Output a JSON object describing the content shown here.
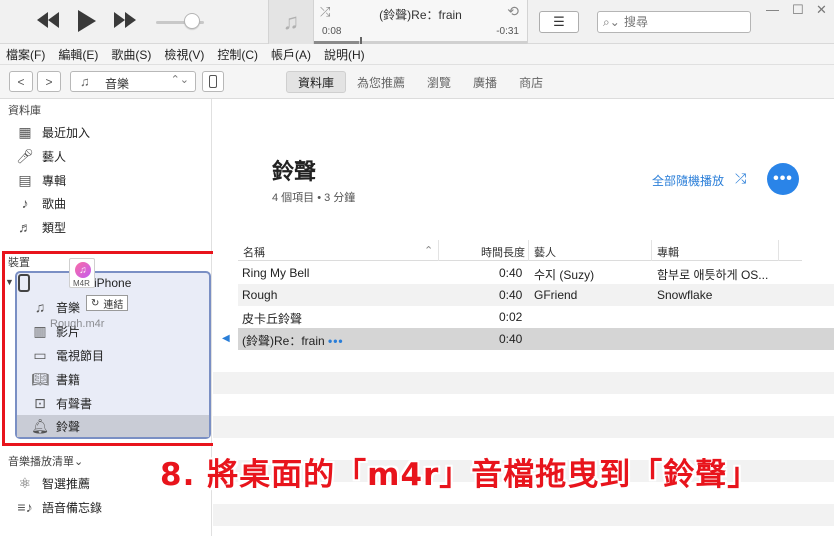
{
  "player": {
    "song": "(鈴聲)Re：frain",
    "elapsed": "0:08",
    "remaining": "-0:31",
    "progress_fraction": 0.21,
    "volume_fraction": 0.75,
    "search_placeholder": "搜尋"
  },
  "menu": [
    "檔案(F)",
    "編輯(E)",
    "歌曲(S)",
    "檢視(V)",
    "控制(C)",
    "帳戶(A)",
    "說明(H)"
  ],
  "nav": {
    "media_kind": "音樂",
    "tabs": [
      "資料庫",
      "為您推薦",
      "瀏覽",
      "廣播",
      "商店"
    ],
    "active_tab": "資料庫"
  },
  "sidebar": {
    "library_header": "資料庫",
    "library_items": [
      {
        "label": "最近加入",
        "icon": "grid-icon"
      },
      {
        "label": "藝人",
        "icon": "microphone-icon"
      },
      {
        "label": "專輯",
        "icon": "album-icon"
      },
      {
        "label": "歌曲",
        "icon": "note-icon"
      },
      {
        "label": "類型",
        "icon": "genre-icon"
      }
    ],
    "devices_header": "裝置",
    "device_name": "iPhone",
    "device_items": [
      {
        "label": "音樂",
        "icon": "note-icon"
      },
      {
        "label": "影片",
        "icon": "film-icon"
      },
      {
        "label": "電視節目",
        "icon": "tv-icon"
      },
      {
        "label": "書籍",
        "icon": "book-icon"
      },
      {
        "label": "有聲書",
        "icon": "audiobook-icon"
      },
      {
        "label": "鈴聲",
        "icon": "bell-icon"
      }
    ],
    "playlists_header": "音樂播放清單",
    "playlist_items": [
      {
        "label": "智選推薦",
        "icon": "atom-icon"
      },
      {
        "label": "語音備忘錄",
        "icon": "memo-list-icon"
      }
    ],
    "drag": {
      "file_ext": "M4R",
      "tag": "連結",
      "file_name": "Rough.m4r"
    }
  },
  "main": {
    "title": "鈴聲",
    "subtitle": "4 個項目 • 3 分鐘",
    "shuffle_all": "全部隨機播放",
    "columns": [
      "名稱",
      "時間長度",
      "藝人",
      "專輯"
    ],
    "rows": [
      {
        "name": "Ring My Bell",
        "time": "0:40",
        "artist": "수지 (Suzy)",
        "album": "함부로 애틋하게 OS..."
      },
      {
        "name": "Rough",
        "time": "0:40",
        "artist": "GFriend",
        "album": "Snowflake"
      },
      {
        "name": "皮卡丘鈴聲",
        "time": "0:02",
        "artist": "",
        "album": ""
      },
      {
        "name": "(鈴聲)Re：frain",
        "time": "0:40",
        "artist": "",
        "album": ""
      }
    ]
  },
  "caption": "8. 將桌面的「m4r」音檔拖曳到「鈴聲」",
  "colors": {
    "accent_blue": "#2a84e8",
    "highlight_red": "#e8141c",
    "device_outline": "#7a8fc4"
  }
}
